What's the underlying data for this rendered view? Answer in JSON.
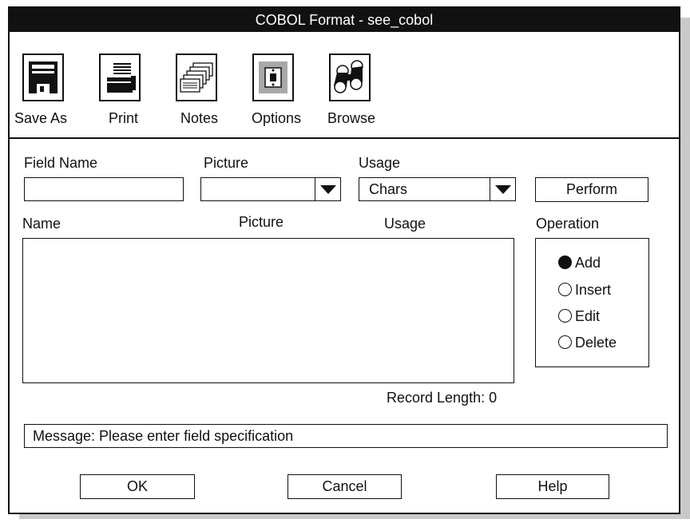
{
  "window": {
    "title": "COBOL Format - see_cobol"
  },
  "toolbar": {
    "items": [
      {
        "label": "Save As",
        "icon": "floppy-disk-icon"
      },
      {
        "label": "Print",
        "icon": "printer-icon"
      },
      {
        "label": "Notes",
        "icon": "notes-icon"
      },
      {
        "label": "Options",
        "icon": "options-switch-icon"
      },
      {
        "label": "Browse",
        "icon": "binoculars-icon"
      }
    ]
  },
  "form": {
    "field_name_label": "Field Name",
    "field_name_value": "",
    "picture_label": "Picture",
    "picture_value": "",
    "usage_label": "Usage",
    "usage_value": "Chars",
    "perform_label": "Perform"
  },
  "list": {
    "columns": [
      "Name",
      "Picture",
      "Usage"
    ],
    "rows": [],
    "record_length": "Record Length: 0"
  },
  "operation": {
    "label": "Operation",
    "options": [
      "Add",
      "Insert",
      "Edit",
      "Delete"
    ],
    "selected": "Add"
  },
  "message": "Message: Please enter field specification",
  "buttons": {
    "ok": "OK",
    "cancel": "Cancel",
    "help": "Help"
  }
}
